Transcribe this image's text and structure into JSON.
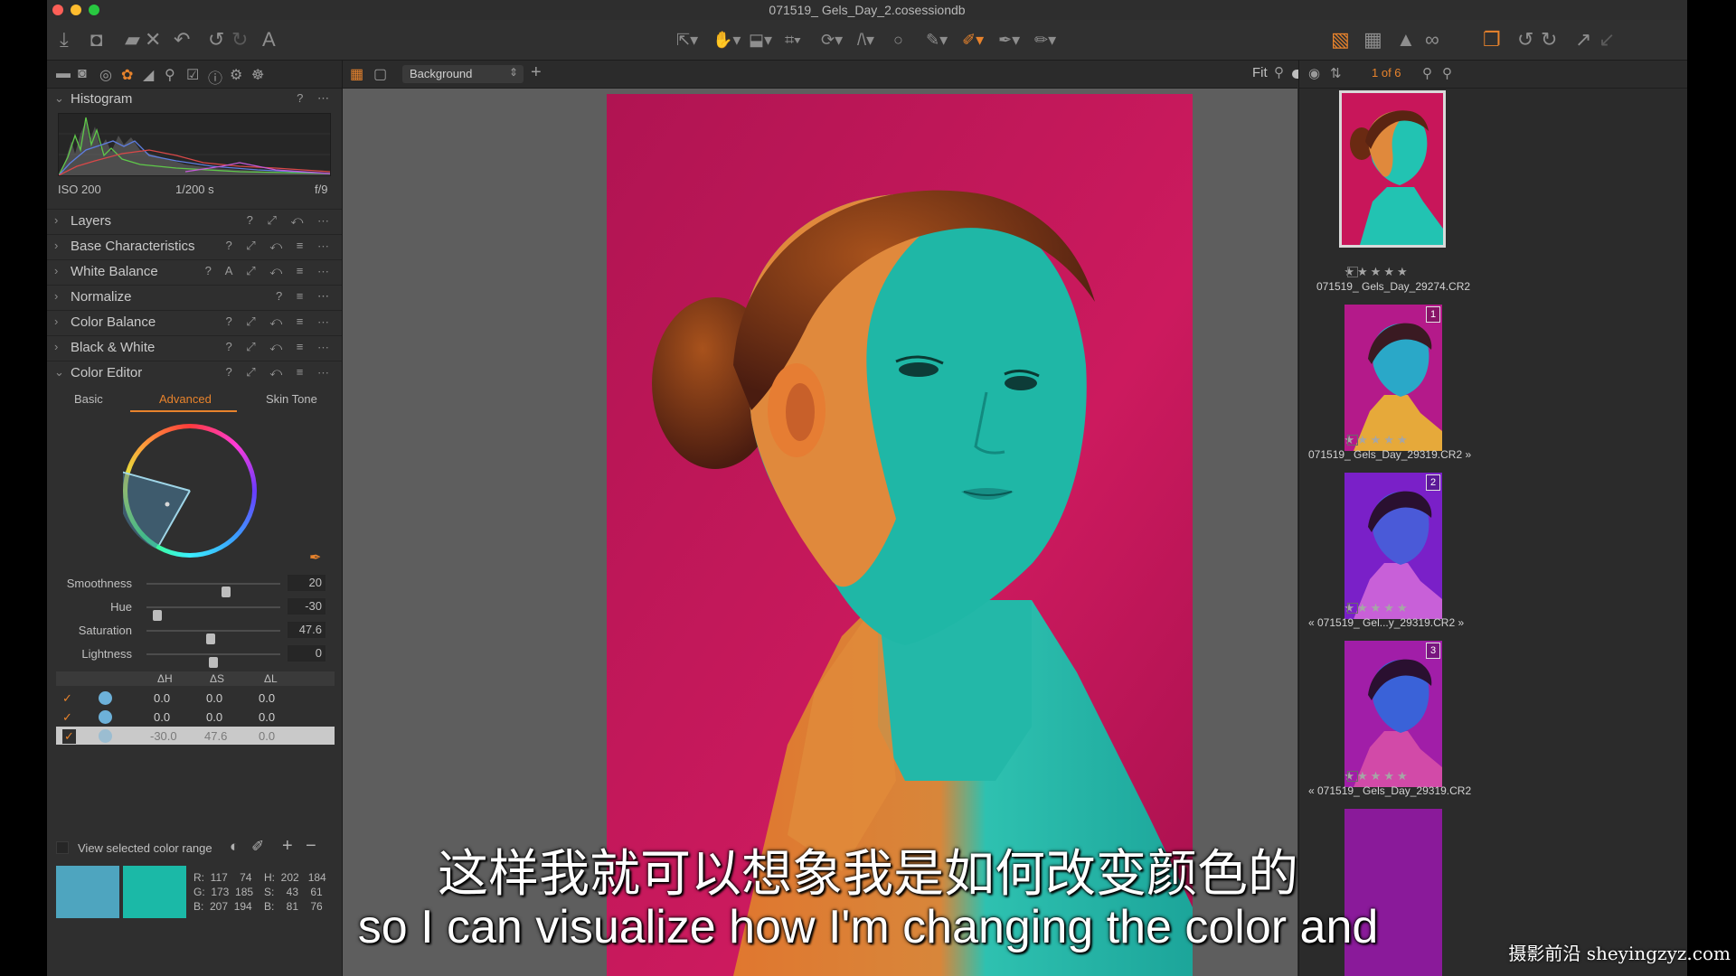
{
  "window": {
    "title": "071519_ Gels_Day_2.cosessiondb"
  },
  "histogram": {
    "title": "Histogram",
    "iso": "ISO 200",
    "shutter": "1/200 s",
    "aperture": "f/9"
  },
  "tool_sections": [
    {
      "label": "Layers"
    },
    {
      "label": "Base Characteristics"
    },
    {
      "label": "White Balance"
    },
    {
      "label": "Normalize"
    },
    {
      "label": "Color Balance"
    },
    {
      "label": "Black & White"
    },
    {
      "label": "Color Editor"
    }
  ],
  "color_editor": {
    "tabs": [
      "Basic",
      "Advanced",
      "Skin Tone"
    ],
    "active_tab": "Advanced",
    "sliders": [
      {
        "label": "Smoothness",
        "value": "20",
        "level": 0.6
      },
      {
        "label": "Hue",
        "value": "-30",
        "level": 0.05
      },
      {
        "label": "Saturation",
        "value": "47.6",
        "level": 0.48
      },
      {
        "label": "Lightness",
        "value": "0",
        "level": 0.5
      }
    ],
    "table_headers": [
      "ΔH",
      "ΔS",
      "ΔL"
    ],
    "rows": [
      {
        "dh": "0.0",
        "ds": "0.0",
        "dl": "0.0"
      },
      {
        "dh": "0.0",
        "ds": "0.0",
        "dl": "0.0"
      },
      {
        "dh": "-30.0",
        "ds": "47.6",
        "dl": "0.0"
      }
    ],
    "view_range_label": "View selected color range",
    "swatch_colors": [
      "#4ea5bf",
      "#1bb9a7"
    ],
    "readout": {
      "r": "R:  117    74",
      "g": "G:  173  185",
      "b": "B:  207  194",
      "h": "H:  202   184",
      "s": "S:    43    61",
      "bb": "B:    81    76"
    }
  },
  "viewer": {
    "layer_select": "Background",
    "zoom": "Fit"
  },
  "browser": {
    "counter": "1 of 6",
    "items": [
      {
        "name": "071519_ Gels_Day_29274.CR2",
        "badge": ""
      },
      {
        "name": "071519_ Gels_Day_29319.CR2 »",
        "badge": "1"
      },
      {
        "name": "« 071519_ Gel...y_29319.CR2 »",
        "badge": "2"
      },
      {
        "name": "« 071519_ Gels_Day_29319.CR2",
        "badge": "3"
      }
    ],
    "stars": "★★★★★"
  },
  "subtitles": {
    "cn": "这样我就可以想象我是如何改变颜色的",
    "en": "so I can visualize how I'm changing the color and"
  },
  "watermark": "摄影前沿 sheyingzyz.com",
  "colors": {
    "accent": "#e8832c",
    "backdrop_magenta": "#c8165a",
    "skin_cyan": "#22c3b2"
  }
}
